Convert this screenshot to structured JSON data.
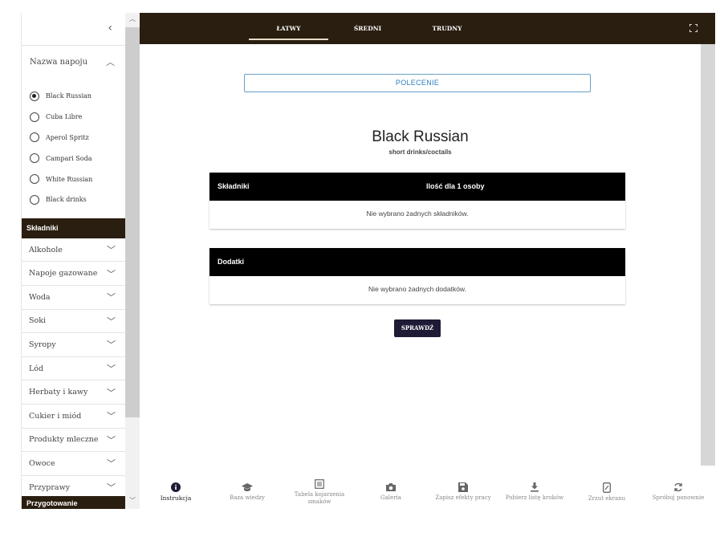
{
  "sidebar": {
    "drink_section": {
      "title": "Nazwa napoju",
      "options": [
        "Black Russian",
        "Cuba Libre",
        "Aperol Spritz",
        "Campari Soda",
        "White Russian",
        "Black drinks"
      ],
      "selected": "Black Russian"
    },
    "ingredients_header": "Składniki",
    "categories": [
      "Alkohole",
      "Napoje gazowane",
      "Woda",
      "Soki",
      "Syropy",
      "Lód",
      "Herbaty i kawy",
      "Cukier i miód",
      "Produkty mleczne",
      "Owoce",
      "Przyprawy"
    ],
    "preparation_header": "Przygotowanie"
  },
  "tabs": [
    {
      "label": "ŁATWY",
      "active": true
    },
    {
      "label": "ŚREDNI",
      "active": false
    },
    {
      "label": "TRUDNY",
      "active": false
    }
  ],
  "main": {
    "instruction_button": "POLECENIE",
    "drink_name": "Black Russian",
    "drink_category": "short drinks/coctails",
    "ingredients_table": {
      "col1": "Składniki",
      "col2": "Ilość dla 1 osoby",
      "empty_message": "Nie wybrano żadnych składników."
    },
    "extras_table": {
      "col1": "Dodatki",
      "empty_message": "Nie wybrano żadnych dodatków."
    },
    "check_button": "SPRAWDŹ"
  },
  "toolbar": [
    {
      "label": "Instrukcja",
      "icon": "info-icon",
      "active": true
    },
    {
      "label": "Baza wiedzy",
      "icon": "graduation-cap-icon",
      "active": false
    },
    {
      "label": "Tabela kojarzenia smaków",
      "icon": "table-icon",
      "active": false
    },
    {
      "label": "Galeria",
      "icon": "camera-icon",
      "active": false
    },
    {
      "label": "Zapisz efekty pracy",
      "icon": "save-icon",
      "active": false
    },
    {
      "label": "Pobierz listę kroków",
      "icon": "download-icon",
      "active": false
    },
    {
      "label": "Zrzut ekranu",
      "icon": "screenshot-icon",
      "active": false
    },
    {
      "label": "Spróbuj ponownie",
      "icon": "refresh-icon",
      "active": false
    }
  ],
  "colors": {
    "dark_brown": "#2a1e10",
    "accent_blue": "#2e7dbd",
    "check_button": "#1f1a36"
  }
}
